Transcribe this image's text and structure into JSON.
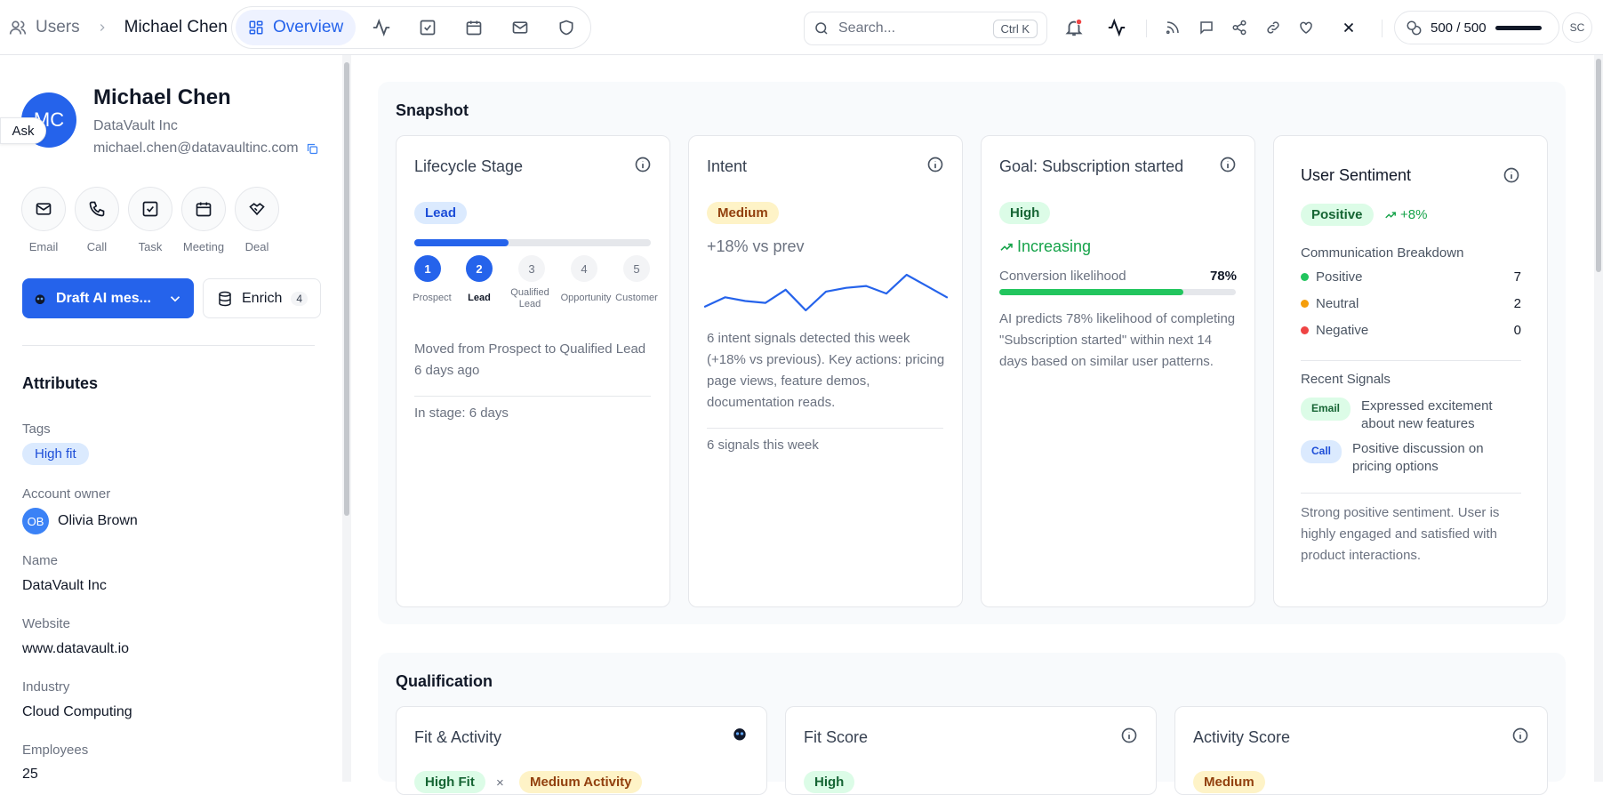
{
  "topbar": {
    "breadcrumb_root": "Users",
    "breadcrumb_current": "Michael Chen",
    "active_tab": "Overview",
    "search_placeholder": "Search...",
    "search_shortcut": "Ctrl K",
    "credits": "500 / 500",
    "user_initials": "SC"
  },
  "profile": {
    "initials": "MC",
    "ask_label": "Ask",
    "name": "Michael Chen",
    "company": "DataVault Inc",
    "email": "michael.chen@datavaultinc.com",
    "actions": [
      "Email",
      "Call",
      "Task",
      "Meeting",
      "Deal"
    ],
    "draft_label": "Draft AI mes...",
    "enrich_label": "Enrich",
    "enrich_count": "4"
  },
  "attributes": {
    "title": "Attributes",
    "tags_label": "Tags",
    "tag": "High fit",
    "owner_label": "Account owner",
    "owner_initials": "OB",
    "owner_name": "Olivia Brown",
    "name_label": "Name",
    "name_value": "DataVault Inc",
    "website_label": "Website",
    "website_value": "www.datavault.io",
    "industry_label": "Industry",
    "industry_value": "Cloud Computing",
    "employees_label": "Employees",
    "employees_value": "25"
  },
  "snapshot": {
    "title": "Snapshot",
    "lifecycle": {
      "title": "Lifecycle Stage",
      "badge": "Lead",
      "progress": 0.4,
      "steps": [
        {
          "num": "1",
          "label": "Prospect"
        },
        {
          "num": "2",
          "label": "Lead"
        },
        {
          "num": "3",
          "label": "Qualified Lead"
        },
        {
          "num": "4",
          "label": "Opportunity"
        },
        {
          "num": "5",
          "label": "Customer"
        }
      ],
      "current_step": 2,
      "note": "Moved from Prospect to Qualified Lead 6 days ago",
      "footer": "In stage: 6 days"
    },
    "intent": {
      "title": "Intent",
      "badge": "Medium",
      "delta": "+18% vs prev",
      "sparkline": [
        3,
        4,
        3.6,
        3.4,
        4.8,
        2.6,
        4.6,
        5,
        5.2,
        4.4,
        6.4,
        5.2,
        4
      ],
      "description": "6 intent signals detected this week (+18% vs previous). Key actions: pricing page views, feature demos, documentation reads.",
      "footer": "6 signals this week"
    },
    "goal": {
      "title": "Goal: Subscription started",
      "badge": "High",
      "trend": "Increasing",
      "likelihood_label": "Conversion likelihood",
      "likelihood_value": "78%",
      "likelihood": 0.78,
      "description": "AI predicts 78% likelihood of completing \"Subscription started\" within next 14 days based on similar user patterns."
    },
    "sentiment": {
      "title": "User Sentiment",
      "badge": "Positive",
      "change": "+8%",
      "breakdown_title": "Communication Breakdown",
      "breakdown": [
        {
          "label": "Positive",
          "count": "7",
          "color": "#22c55e"
        },
        {
          "label": "Neutral",
          "count": "2",
          "color": "#f59e0b"
        },
        {
          "label": "Negative",
          "count": "0",
          "color": "#ef4444"
        }
      ],
      "signals_title": "Recent Signals",
      "signals": [
        {
          "type": "Email",
          "text": "Expressed excitement about new features"
        },
        {
          "type": "Call",
          "text": "Positive discussion on pricing options"
        }
      ],
      "summary": "Strong positive sentiment. User is highly engaged and satisfied with product interactions."
    }
  },
  "qualification": {
    "title": "Qualification",
    "fit_activity": {
      "title": "Fit & Activity",
      "fit_badge": "High Fit",
      "sep": "×",
      "activity_badge": "Medium Activity"
    },
    "fit_score": {
      "title": "Fit Score",
      "badge": "High"
    },
    "activity_score": {
      "title": "Activity Score",
      "badge": "Medium"
    }
  },
  "colors": {
    "accent": "#2563eb",
    "success": "#22c55e",
    "warning": "#f59e0b",
    "danger": "#ef4444"
  }
}
